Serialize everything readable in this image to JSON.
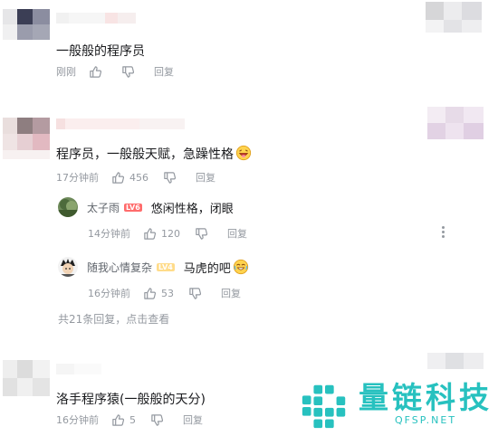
{
  "comments": [
    {
      "text": "一般般的程序员",
      "time": "刚刚",
      "like_count": "",
      "reply_label": "回复"
    },
    {
      "text": "程序员，一般般天赋，急躁性格",
      "emoji": "grin-emoji",
      "time": "17分钟前",
      "like_count": "456",
      "reply_label": "回复",
      "replies": [
        {
          "user": "太子雨",
          "level": "LV6",
          "text": "悠闲性格，闭眼",
          "time": "14分钟前",
          "like_count": "120",
          "reply_label": "回复"
        },
        {
          "user": "随我心情复杂",
          "level": "LV4",
          "text": "马虎的吧",
          "emoji": "laugh-emoji",
          "time": "16分钟前",
          "like_count": "53",
          "reply_label": "回复"
        }
      ],
      "more_replies": "共21条回复，点击查看"
    },
    {
      "text": "洛手程序猿(一般般的天分)",
      "time": "16分钟前",
      "like_count": "5",
      "reply_label": "回复"
    }
  ],
  "watermark": {
    "title": "量链科技",
    "subtitle": "QFSP.NET"
  },
  "colors": {
    "accent": "#27c1bf",
    "meta_gray": "#9499a0",
    "level6": "#ff6c6c",
    "level4": "#ffdc8a"
  }
}
